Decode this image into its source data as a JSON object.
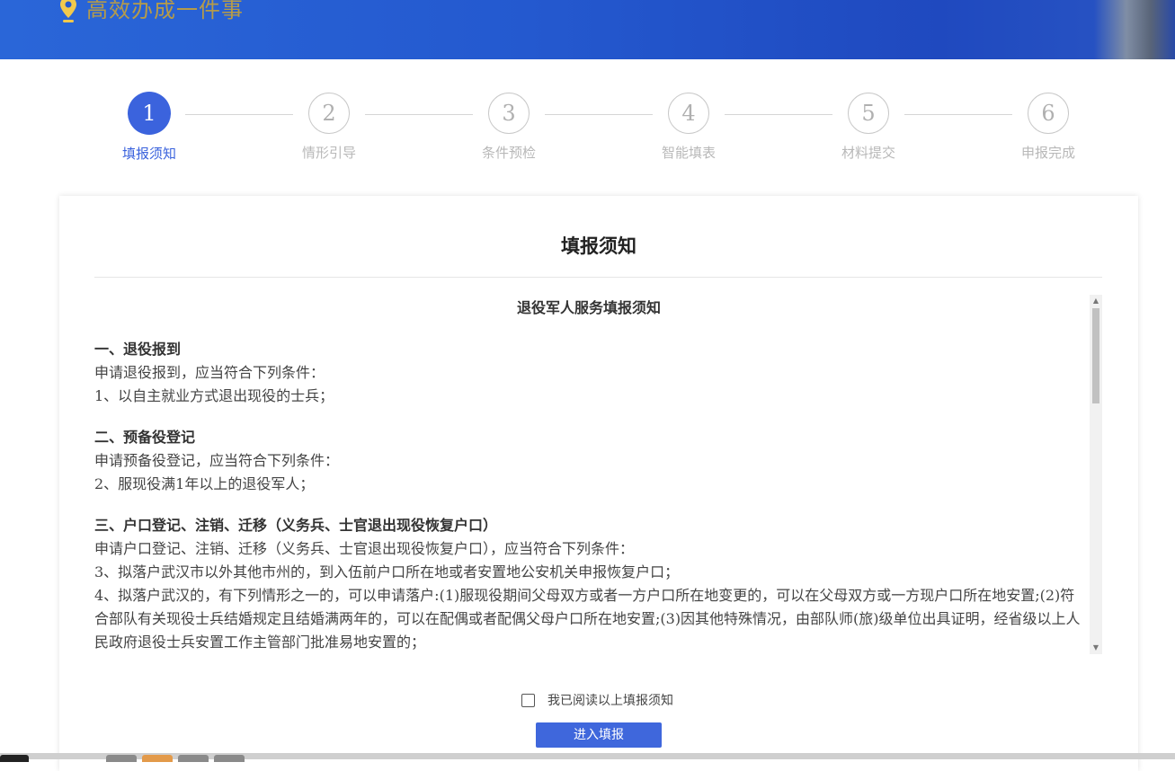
{
  "header": {
    "title": "高效办成一件事"
  },
  "steps": [
    {
      "number": "1",
      "label": "填报须知"
    },
    {
      "number": "2",
      "label": "情形引导"
    },
    {
      "number": "3",
      "label": "条件预检"
    },
    {
      "number": "4",
      "label": "智能填表"
    },
    {
      "number": "5",
      "label": "材料提交"
    },
    {
      "number": "6",
      "label": "申报完成"
    }
  ],
  "card": {
    "title": "填报须知",
    "notice_heading": "退役军人服务填报须知",
    "sections": [
      {
        "title": "一、退役报到",
        "lines": [
          "申请退役报到，应当符合下列条件：",
          "1、以自主就业方式退出现役的士兵；"
        ]
      },
      {
        "title": "二、预备役登记",
        "lines": [
          "申请预备役登记，应当符合下列条件：",
          "2、服现役满1年以上的退役军人；"
        ]
      },
      {
        "title": "三、户口登记、注销、迁移（义务兵、士官退出现役恢复户口）",
        "lines": [
          "申请户口登记、注销、迁移（义务兵、士官退出现役恢复户口），应当符合下列条件：",
          "3、拟落户武汉市以外其他市州的，到入伍前户口所在地或者安置地公安机关申报恢复户口；",
          "4、拟落户武汉的，有下列情形之一的，可以申请落户:(1)服现役期间父母双方或者一方户口所在地变更的，可以在父母双方或一方现户口所在地安置;(2)符合部队有关现役士兵结婚规定且结婚满两年的，可以在配偶或者配偶父母户口所在地安置;(3)因其他特殊情况，由部队师(旅)级单位出具证明，经省级以上人民政府退役士兵安置工作主管部门批准易地安置的；"
        ]
      }
    ],
    "agree_label": "我已阅读以上填报须知",
    "enter_button": "进入填报"
  },
  "colors": {
    "accent": "#3b63dd",
    "header_bg": "#2459cf",
    "inactive_step": "#b8b8b8"
  }
}
